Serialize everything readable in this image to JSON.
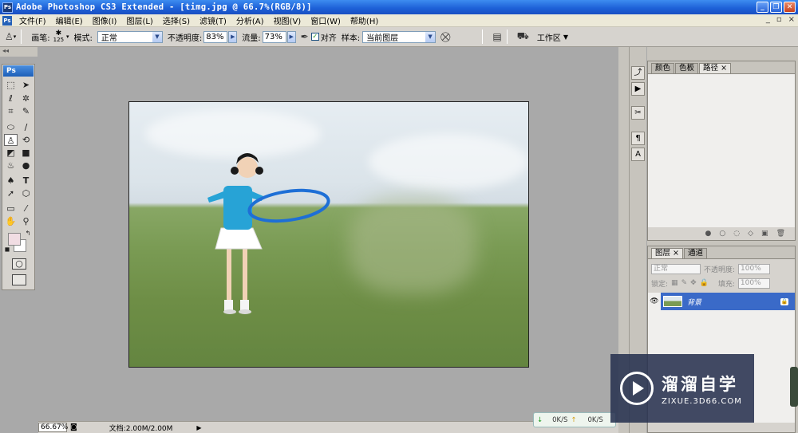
{
  "window": {
    "title": "Adobe Photoshop CS3 Extended - [timg.jpg @ 66.7%(RGB/8)]",
    "app_icon": "Ps",
    "controls": [
      "minimize-icon",
      "restore-icon",
      "close-icon"
    ]
  },
  "menu": {
    "items": [
      "文件(F)",
      "编辑(E)",
      "图像(I)",
      "图层(L)",
      "选择(S)",
      "滤镜(T)",
      "分析(A)",
      "视图(V)",
      "窗口(W)",
      "帮助(H)"
    ],
    "doc_controls": [
      "_",
      "▫",
      "×"
    ]
  },
  "options": {
    "brush_label": "画笔:",
    "brush_size": "125",
    "mode_label": "模式:",
    "mode_value": "正常",
    "opacity_label": "不透明度:",
    "opacity_value": "83%",
    "flow_label": "流量:",
    "flow_value": "73%",
    "aligned_label": "对齐",
    "aligned_checked": true,
    "sample_label": "样本:",
    "sample_value": "当前图层",
    "workspace_label": "工作区"
  },
  "toolbox": {
    "logo": "Ps",
    "tools": [
      "marquee-tool",
      "move-tool",
      "lasso-tool",
      "magic-wand-tool",
      "crop-tool",
      "slice-tool",
      "healing-brush-tool",
      "brush-tool",
      "clone-stamp-tool",
      "history-brush-tool",
      "eraser-tool",
      "gradient-tool",
      "blur-tool",
      "dodge-tool",
      "pen-tool",
      "type-tool",
      "path-selection-tool",
      "shape-tool",
      "notes-tool",
      "eyedropper-tool",
      "hand-tool",
      "zoom-tool"
    ],
    "foreground_color": "#f1dde3",
    "background_color": "#ffffff"
  },
  "document": {
    "filename": "timg.jpg",
    "zoom": "66.67%",
    "doc_info": "文档:2.00M/2.00M"
  },
  "network_widget": {
    "down": "0K/S",
    "up": "0K/S"
  },
  "panels": {
    "top_tabs": [
      "颜色",
      "色板",
      "路径"
    ],
    "layer_tabs": [
      "图层",
      "通道"
    ],
    "blend_mode": "正常",
    "opacity_label": "不透明度:",
    "opacity_value": "100%",
    "lock_label": "锁定:",
    "fill_label": "填充:",
    "fill_value": "100%",
    "layer_name": "背景"
  },
  "watermark": {
    "brand_cn": "溜溜自学",
    "brand_url": "ZIXUE.3D66.COM"
  }
}
